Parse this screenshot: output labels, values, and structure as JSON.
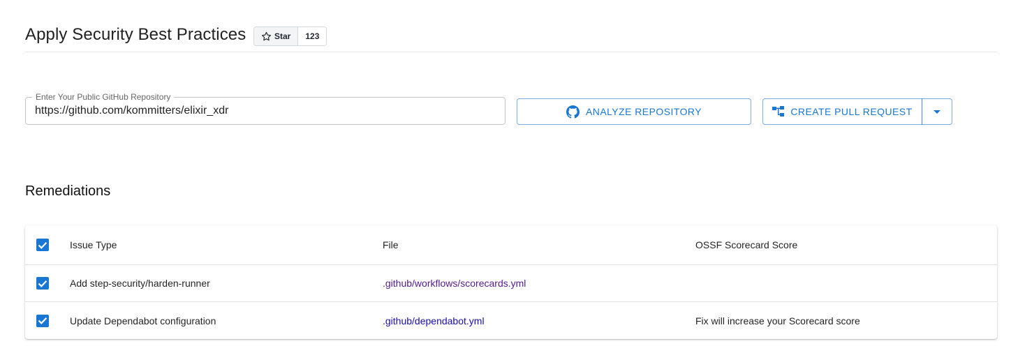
{
  "header": {
    "title": "Apply Security Best Practices",
    "star_label": "Star",
    "star_count": "123"
  },
  "form": {
    "repo_label": "Enter Your Public GitHub Repository",
    "repo_value": "https://github.com/kommitters/elixir_xdr",
    "analyze_label": "ANALYZE REPOSITORY",
    "create_pr_label": "CREATE PULL REQUEST"
  },
  "remediations": {
    "title": "Remediations",
    "columns": [
      "Issue Type",
      "File",
      "OSSF Scorecard Score"
    ],
    "rows": [
      {
        "issue": "Add step-security/harden-runner",
        "file": ".github/workflows/scorecards.yml",
        "score": "",
        "checked": true
      },
      {
        "issue": "Update Dependabot configuration",
        "file": ".github/dependabot.yml",
        "score": "Fix will increase your Scorecard score",
        "checked": true
      }
    ],
    "header_checked": true
  },
  "colors": {
    "primary": "#1976d2",
    "visited_link": "#551a8b",
    "link": "#1a0dab"
  },
  "icons": {
    "star": "star-outline-icon",
    "analyze": "github-icon",
    "create_pr": "pull-request-icon",
    "dropdown": "caret-down-icon",
    "checkbox": "checkmark-icon"
  }
}
